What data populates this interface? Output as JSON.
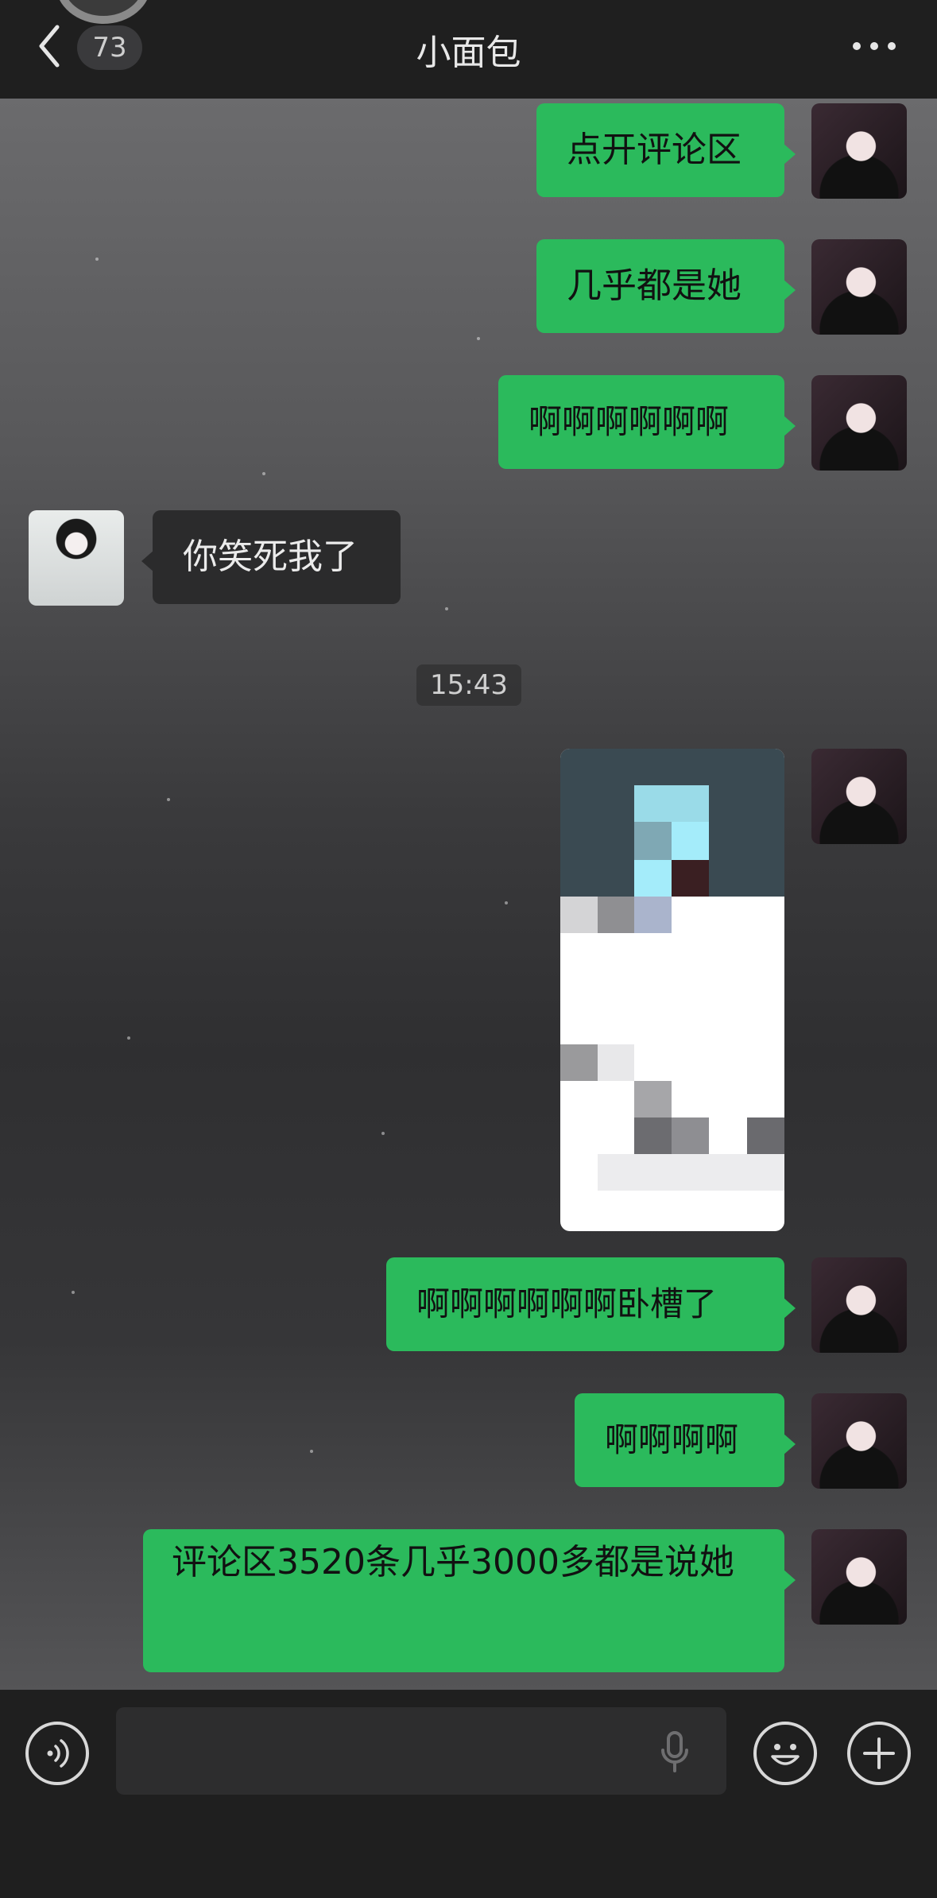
{
  "header": {
    "unread_count": "73",
    "title": "小面包"
  },
  "messages": [
    {
      "side": "right",
      "type": "text",
      "text": "点开评论区"
    },
    {
      "side": "right",
      "type": "text",
      "text": "几乎都是她"
    },
    {
      "side": "right",
      "type": "text",
      "text": "啊啊啊啊啊啊"
    },
    {
      "side": "left",
      "type": "text",
      "text": "你笑死我了"
    },
    {
      "type": "timestamp",
      "text": "15:43"
    },
    {
      "side": "right",
      "type": "image",
      "content": "pixelated screenshot"
    },
    {
      "side": "right",
      "type": "text",
      "text": "啊啊啊啊啊啊卧槽了"
    },
    {
      "side": "right",
      "type": "text",
      "text": "啊啊啊啊"
    },
    {
      "side": "right",
      "type": "text",
      "text": "评论区3520条几乎3000多都是说她"
    }
  ],
  "input": {
    "value": "",
    "placeholder": ""
  },
  "icons": {
    "back": "chevron-left-icon",
    "more": "more-dots-icon",
    "voice": "voice-toggle-icon",
    "mic": "microphone-icon",
    "emoji": "emoji-icon",
    "plus": "plus-icon"
  },
  "colors": {
    "outgoing_bubble": "#2bba5c",
    "incoming_bubble": "#2b2b2c",
    "header_bg": "#1f1f1f"
  }
}
